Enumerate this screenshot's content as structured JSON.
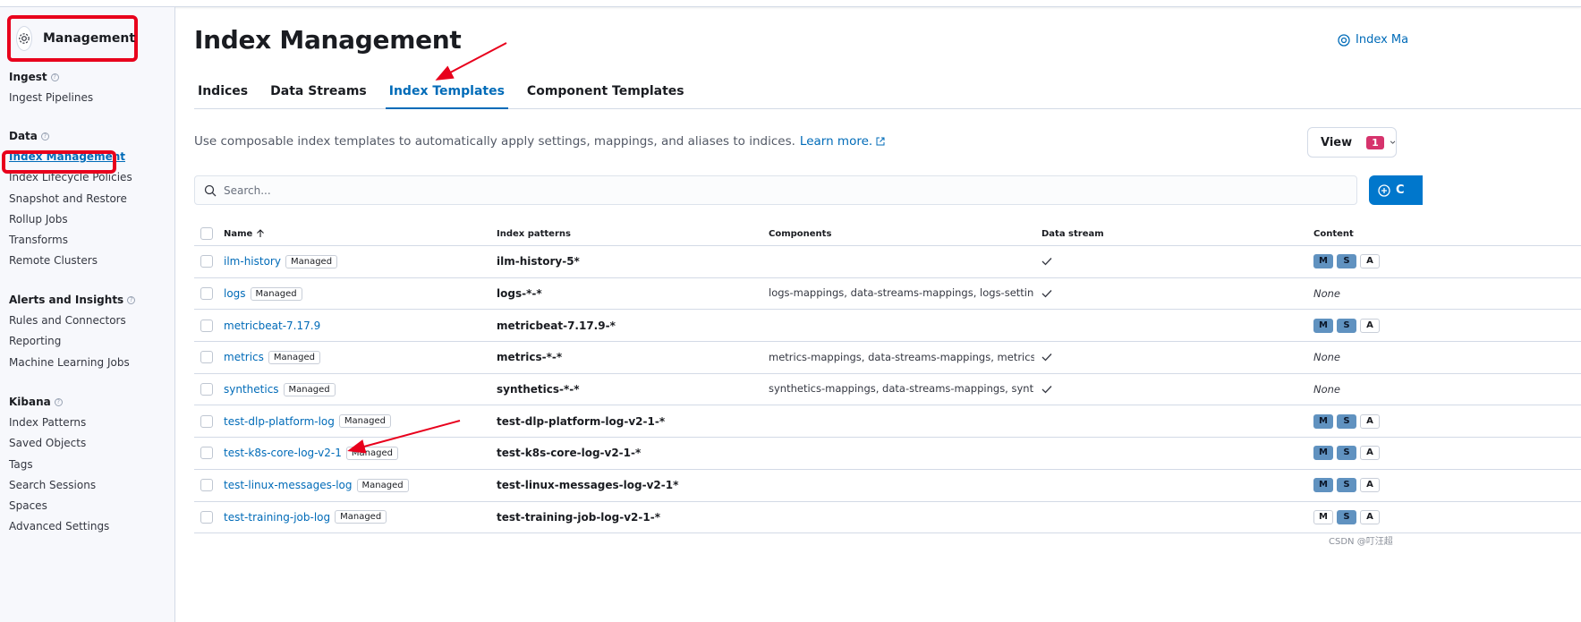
{
  "sidebar": {
    "title": "Management",
    "groups": [
      {
        "title": "Ingest",
        "items": [
          "Ingest Pipelines"
        ]
      },
      {
        "title": "Data",
        "items": [
          "Index Management",
          "Index Lifecycle Policies",
          "Snapshot and Restore",
          "Rollup Jobs",
          "Transforms",
          "Remote Clusters"
        ]
      },
      {
        "title": "Alerts and Insights",
        "items": [
          "Rules and Connectors",
          "Reporting",
          "Machine Learning Jobs"
        ]
      },
      {
        "title": "Kibana",
        "items": [
          "Index Patterns",
          "Saved Objects",
          "Tags",
          "Search Sessions",
          "Spaces",
          "Advanced Settings"
        ]
      }
    ],
    "active_item": "Index Management"
  },
  "page": {
    "title": "Index Management",
    "doc_link": "Index Ma",
    "description": "Use composable index templates to automatically apply settings, mappings, and aliases to indices.",
    "learn_more": "Learn more.",
    "view_label": "View",
    "view_count": "1",
    "search_placeholder": "Search...",
    "create_label": "C"
  },
  "tabs": [
    {
      "label": "Indices",
      "selected": false
    },
    {
      "label": "Data Streams",
      "selected": false
    },
    {
      "label": "Index Templates",
      "selected": true
    },
    {
      "label": "Component Templates",
      "selected": false
    }
  ],
  "table": {
    "headers": {
      "name": "Name",
      "patterns": "Index patterns",
      "components": "Components",
      "data_stream": "Data stream",
      "content": "Content"
    },
    "sort_icon": "arrow-up-icon",
    "rows": [
      {
        "name": "ilm-history",
        "managed": "Managed",
        "pattern": "ilm-history-5*",
        "components": "",
        "data_stream": true,
        "content": {
          "M": true,
          "S": true,
          "A": false
        }
      },
      {
        "name": "logs",
        "managed": "Managed",
        "pattern": "logs-*-*",
        "components": "logs-mappings, data-streams-mappings, logs-settings",
        "data_stream": true,
        "content": "None"
      },
      {
        "name": "metricbeat-7.17.9",
        "managed": "",
        "pattern": "metricbeat-7.17.9-*",
        "components": "",
        "data_stream": false,
        "content": {
          "M": true,
          "S": true,
          "A": false
        }
      },
      {
        "name": "metrics",
        "managed": "Managed",
        "pattern": "metrics-*-*",
        "components": "metrics-mappings, data-streams-mappings, metrics-s",
        "data_stream": true,
        "content": "None"
      },
      {
        "name": "synthetics",
        "managed": "Managed",
        "pattern": "synthetics-*-*",
        "components": "synthetics-mappings, data-streams-mappings, synthe",
        "data_stream": true,
        "content": "None"
      },
      {
        "name": "test-dlp-platform-log",
        "managed": "Managed",
        "pattern": "test-dlp-platform-log-v2-1-*",
        "components": "",
        "data_stream": false,
        "content": {
          "M": true,
          "S": true,
          "A": false
        }
      },
      {
        "name": "test-k8s-core-log-v2-1",
        "managed": "Managed",
        "pattern": "test-k8s-core-log-v2-1-*",
        "components": "",
        "data_stream": false,
        "content": {
          "M": true,
          "S": true,
          "A": false
        }
      },
      {
        "name": "test-linux-messages-log",
        "managed": "Managed",
        "pattern": "test-linux-messages-log-v2-1*",
        "components": "",
        "data_stream": false,
        "content": {
          "M": true,
          "S": true,
          "A": false
        }
      },
      {
        "name": "test-training-job-log",
        "managed": "Managed",
        "pattern": "test-training-job-log-v2-1-*",
        "components": "",
        "data_stream": false,
        "content": {
          "M": false,
          "S": true,
          "A": false
        }
      }
    ]
  },
  "watermark": "CSDN @叮汪超",
  "colors": {
    "accent": "#006bb8",
    "annotation": "#e8001c",
    "badge": "#d6336c",
    "primary_button": "#0077cc"
  }
}
